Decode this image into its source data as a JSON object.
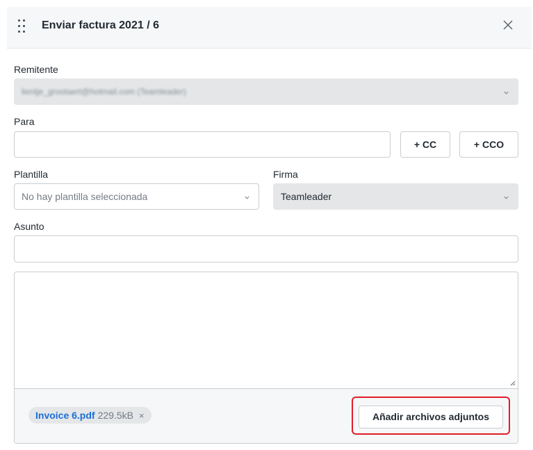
{
  "header": {
    "title": "Enviar factura 2021 / 6"
  },
  "icons": {
    "drag": "drag-handle-icon",
    "close": "close-icon",
    "chevron": "chevron-down-icon",
    "resize": "resize-handle-icon"
  },
  "sender": {
    "label": "Remitente",
    "value": "lientje_grootaert@hotmail.com (Teamleader)"
  },
  "recipient": {
    "label": "Para",
    "value": "",
    "cc_label": "+ CC",
    "cco_label": "+ CCO"
  },
  "template": {
    "label": "Plantilla",
    "placeholder": "No hay plantilla seleccionada"
  },
  "signature": {
    "label": "Firma",
    "value": "Teamleader"
  },
  "subject": {
    "label": "Asunto",
    "value": ""
  },
  "body": {
    "text": ""
  },
  "attachment": {
    "name": "Invoice 6.pdf",
    "size": "229.5kB",
    "remove": "×"
  },
  "footer": {
    "add_attachments_label": "Añadir archivos adjuntos"
  },
  "colors": {
    "accent_link": "#1a6ed8",
    "highlight": "#e11d2a",
    "header_bg": "#f6f7f8",
    "disabled_bg": "#e4e6e8"
  }
}
